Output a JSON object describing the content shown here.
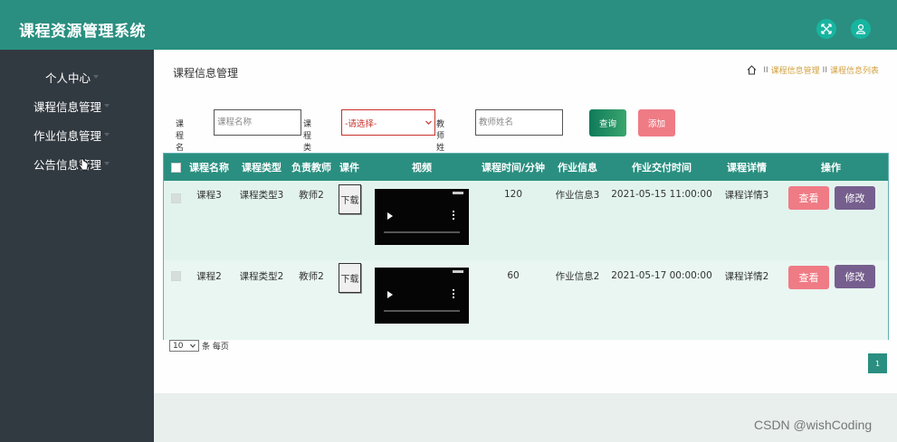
{
  "app": {
    "title": "课程资源管理系统"
  },
  "header": {
    "buttons": [
      {
        "icon": "expand-icon"
      },
      {
        "icon": "user-icon"
      }
    ]
  },
  "sidebar": {
    "items": [
      {
        "label": "个人中心"
      },
      {
        "label": "课程信息管理"
      },
      {
        "label": "作业信息管理"
      },
      {
        "label": "公告信息管理"
      }
    ]
  },
  "page": {
    "title": "课程信息管理",
    "breadcrumb": [
      "课程信息管理",
      "课程信息列表"
    ],
    "breadcrumb_sep": "II"
  },
  "search": {
    "course_name_label": "课程名称",
    "course_name_placeholder": "课程名称",
    "course_type_label": "课程类型",
    "course_type_selected": "-请选择-",
    "teacher_label": "教师姓名",
    "teacher_placeholder": "教师姓名",
    "query_label": "查询",
    "add_label": "添加"
  },
  "table": {
    "columns": [
      "课程名称",
      "课程类型",
      "负责教师",
      "课件",
      "视频",
      "课程时间/分钟",
      "作业信息",
      "作业交付时间",
      "课程详情",
      "操作"
    ],
    "rows": [
      {
        "name": "课程3",
        "type": "课程类型3",
        "teacher": "教师2",
        "file_label": "下载",
        "duration": "120",
        "homework": "作业信息3",
        "due": "2021-05-15 11:00:00",
        "detail": "课程详情3",
        "view": "查看",
        "edit": "修改"
      },
      {
        "name": "课程2",
        "type": "课程类型2",
        "teacher": "教师2",
        "file_label": "下载",
        "duration": "60",
        "homework": "作业信息2",
        "due": "2021-05-17 00:00:00",
        "detail": "课程详情2",
        "view": "查看",
        "edit": "修改"
      }
    ]
  },
  "pager": {
    "page_size": "10",
    "per_page_label": "条 每页",
    "current_page": "1"
  },
  "watermark": "CSDN @wishCoding",
  "colors": {
    "primary": "#2a8f80",
    "sidebar": "#323a41",
    "view": "#ef7b85",
    "edit": "#765f8e",
    "add": "#ef7b85",
    "breadcrumb": "#d4a243"
  }
}
